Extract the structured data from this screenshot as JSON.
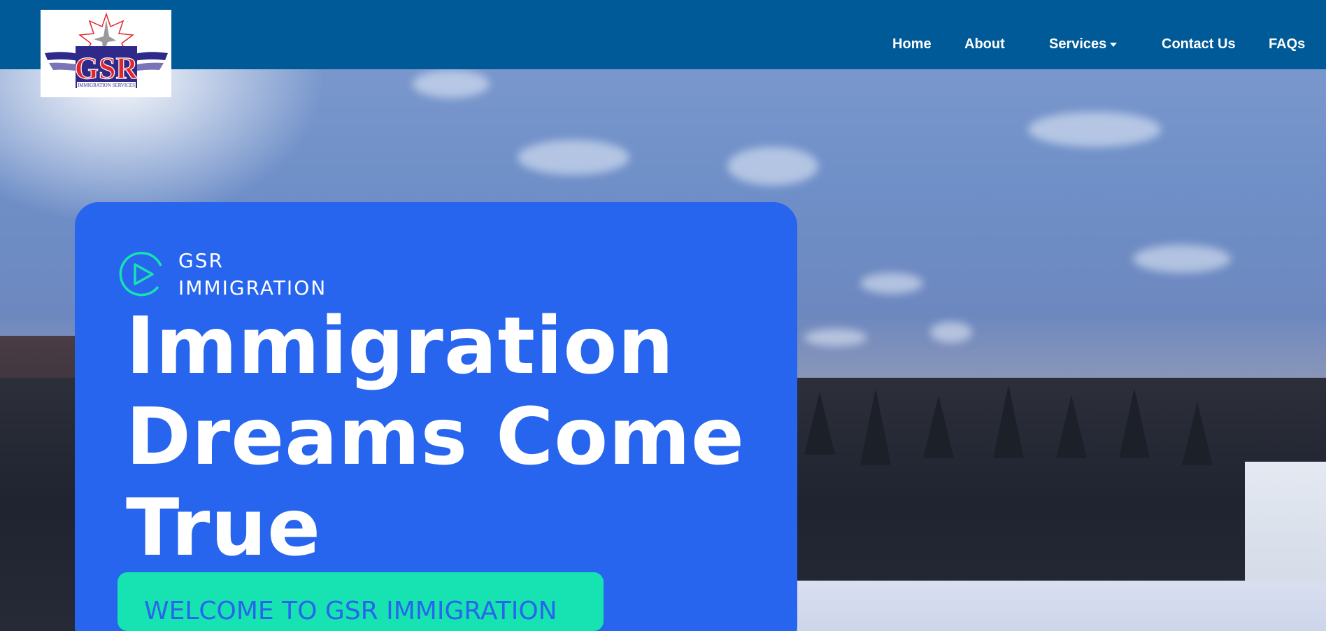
{
  "logo": {
    "text": "GSR",
    "subtext": "IMMIGRATION SERVICES",
    "colors": {
      "primary": "#e0262c",
      "secondary": "#2f2a8a"
    }
  },
  "nav": {
    "background": "#005a98",
    "items": [
      {
        "label": "Home"
      },
      {
        "label": "About"
      },
      {
        "label": "Services",
        "has_dropdown": true
      },
      {
        "label": "Contact Us"
      },
      {
        "label": "FAQs"
      }
    ]
  },
  "hero": {
    "card_color": "#2765ee",
    "brand_line_1": "GSR",
    "brand_line_2": "IMMIGRATION",
    "headline_1": "Immigration",
    "headline_2": "Dreams Come",
    "headline_3": "True",
    "cta_label": "WELCOME TO GSR IMMIGRATION",
    "cta_color": "#16e2b2",
    "play_icon": "play-circle-icon",
    "play_icon_color": "#16e2b2"
  }
}
